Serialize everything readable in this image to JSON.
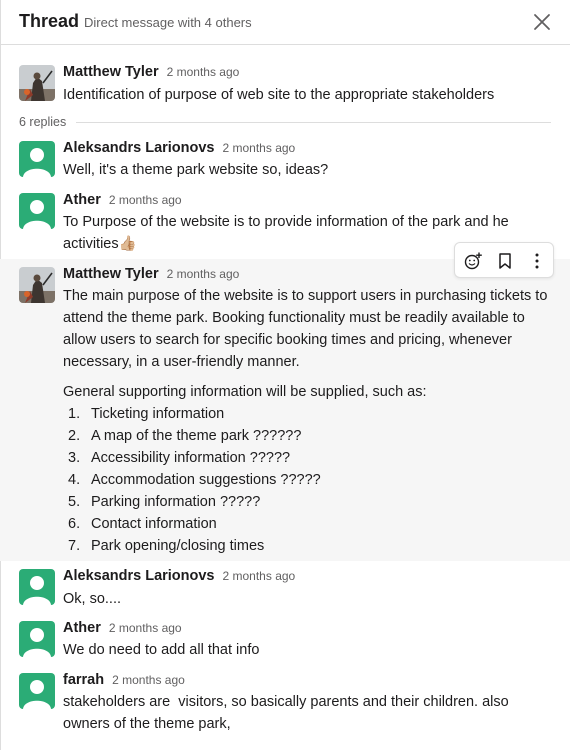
{
  "header": {
    "title": "Thread",
    "subtitle": "Direct message with 4 others"
  },
  "parent": {
    "author": "Matthew Tyler",
    "time": "2 months ago",
    "text": "Identification of purpose of web site to the appropriate stakeholders"
  },
  "replies_label": "6 replies",
  "messages": [
    {
      "author": "Aleksandrs Larionovs",
      "time": "2 months ago",
      "text": "Well, it's a theme park website so, ideas?"
    },
    {
      "author": "Ather",
      "time": "2 months ago",
      "text": "To Purpose of the website is to provide information of the park and he activities",
      "emoji": "👍🏼"
    },
    {
      "author": "Matthew Tyler",
      "time": "2 months ago",
      "text": "The main purpose of the website is to support users in purchasing tickets to attend the theme park. Booking functionality must be readily available to allow users to search for specific booking times and pricing, whenever necessary, in a user-friendly manner.",
      "text2": "General supporting information will be supplied, such as:",
      "list": [
        {
          "num": "1.",
          "text": "Ticketing information"
        },
        {
          "num": "2.",
          "text": "A map of the theme park ??????"
        },
        {
          "num": "3.",
          "text": "Accessibility information ?????"
        },
        {
          "num": "4.",
          "text": "Accommodation suggestions ?????"
        },
        {
          "num": "5.",
          "text": "Parking information ?????"
        },
        {
          "num": "6.",
          "text": "Contact information"
        },
        {
          "num": "7.",
          "text": "Park opening/closing times"
        }
      ]
    },
    {
      "author": "Aleksandrs Larionovs",
      "time": "2 months ago",
      "text": "Ok, so...."
    },
    {
      "author": "Ather",
      "time": "2 months ago",
      "text": "We do need to add all that info"
    },
    {
      "author": "farrah",
      "time": "2 months ago",
      "text": "stakeholders are  visitors, so basically parents and their children. also owners of the theme park,"
    }
  ],
  "toolbar_icons": [
    "add-reaction-icon",
    "bookmark-icon",
    "more-actions-icon"
  ],
  "colors": {
    "avatar_green": "#2bac76",
    "highlight": "#f6f6f6",
    "muted": "#616061"
  }
}
